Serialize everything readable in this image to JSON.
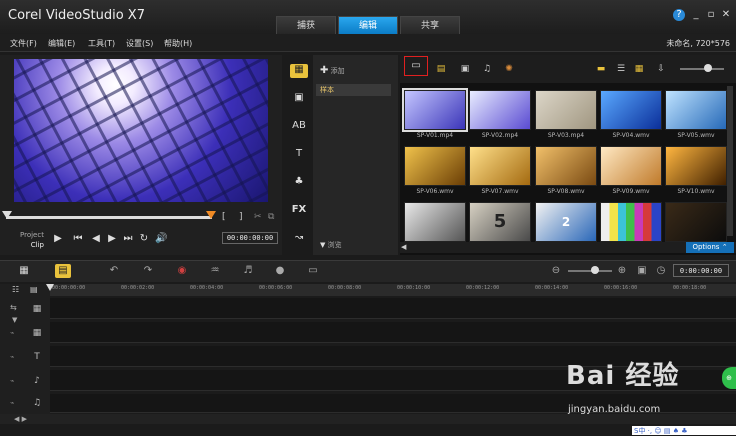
{
  "app": {
    "title": "Corel VideoStudio X7"
  },
  "mode_tabs": [
    {
      "label": "捕获"
    },
    {
      "label": "编辑"
    },
    {
      "label": "共享"
    }
  ],
  "window_controls": {
    "help": "?",
    "minimize": "_",
    "restore": "▫",
    "close": "✕"
  },
  "menu": [
    {
      "label": "文件(F)"
    },
    {
      "label": "编辑(E)"
    },
    {
      "label": "工具(T)"
    },
    {
      "label": "设置(S)"
    },
    {
      "label": "帮助(H)"
    }
  ],
  "project_info": "未命名, 720*576",
  "player": {
    "mode_project": "Project",
    "mode_clip": "Clip",
    "timecode": "00:00:00:00",
    "trim_in": "[",
    "trim_out": "]"
  },
  "folder_pane": {
    "add_label": "添加",
    "sample_folder": "样本",
    "browse_label": "浏览"
  },
  "library": {
    "thumbnails": [
      {
        "label": "SP-V01.mp4",
        "colors": [
          "#c4c6ff",
          "#3b35b8"
        ]
      },
      {
        "label": "SP-V02.mp4",
        "colors": [
          "#e8ecff",
          "#5a4bd2"
        ]
      },
      {
        "label": "SP-V03.mp4",
        "colors": [
          "#dcd6c8",
          "#a09680"
        ]
      },
      {
        "label": "SP-V04.wmv",
        "colors": [
          "#5aa9ff",
          "#0b2f9a"
        ]
      },
      {
        "label": "SP-V05.wmv",
        "colors": [
          "#bfe3ff",
          "#2669b8"
        ]
      },
      {
        "label": "SP-V06.wmv",
        "colors": [
          "#f0c24b",
          "#6b3e05"
        ]
      },
      {
        "label": "SP-V07.wmv",
        "colors": [
          "#ffe08a",
          "#a46a10"
        ]
      },
      {
        "label": "SP-V08.wmv",
        "colors": [
          "#f1c06a",
          "#7a4a12"
        ]
      },
      {
        "label": "SP-V09.wmv",
        "colors": [
          "#ffe9c4",
          "#c07a2a"
        ]
      },
      {
        "label": "SP-V10.wmv",
        "colors": [
          "#ffb640",
          "#402000"
        ]
      },
      {
        "label": "",
        "colors": [
          "#e8e8e8",
          "#555555"
        ]
      },
      {
        "label": "",
        "colors": [
          "#d6d0c2",
          "#4a4a4a"
        ]
      },
      {
        "label": "",
        "colors": [
          "#f2f2f2",
          "#2a67b8"
        ]
      },
      {
        "label": "",
        "colors": [
          "#ffffff",
          "#8a8a8a"
        ]
      },
      {
        "label": "",
        "colors": [
          "#3a2a18",
          "#0c0c0c"
        ]
      }
    ],
    "countdown_digit": "5",
    "screen_digit": "2",
    "options_label": "Options"
  },
  "timeline": {
    "timecode": "0:00:00:00",
    "ruler_labels": [
      "00:00:00:00",
      "00:00:02:00",
      "00:00:04:00",
      "00:00:06:00",
      "00:00:08:00",
      "00:00:10:00",
      "00:00:12:00",
      "00:00:14:00",
      "00:00:16:00",
      "00:00:18:00"
    ]
  },
  "watermark": {
    "logo": "Bai 经验",
    "url": "jingyan.baidu.com"
  },
  "tray_text": "S中 ·, ☺ ▤ ♠ ♣",
  "colors": {
    "accent": "#1c92dc",
    "highlight_border": "#e02020",
    "options_bg": "#1570b8"
  }
}
